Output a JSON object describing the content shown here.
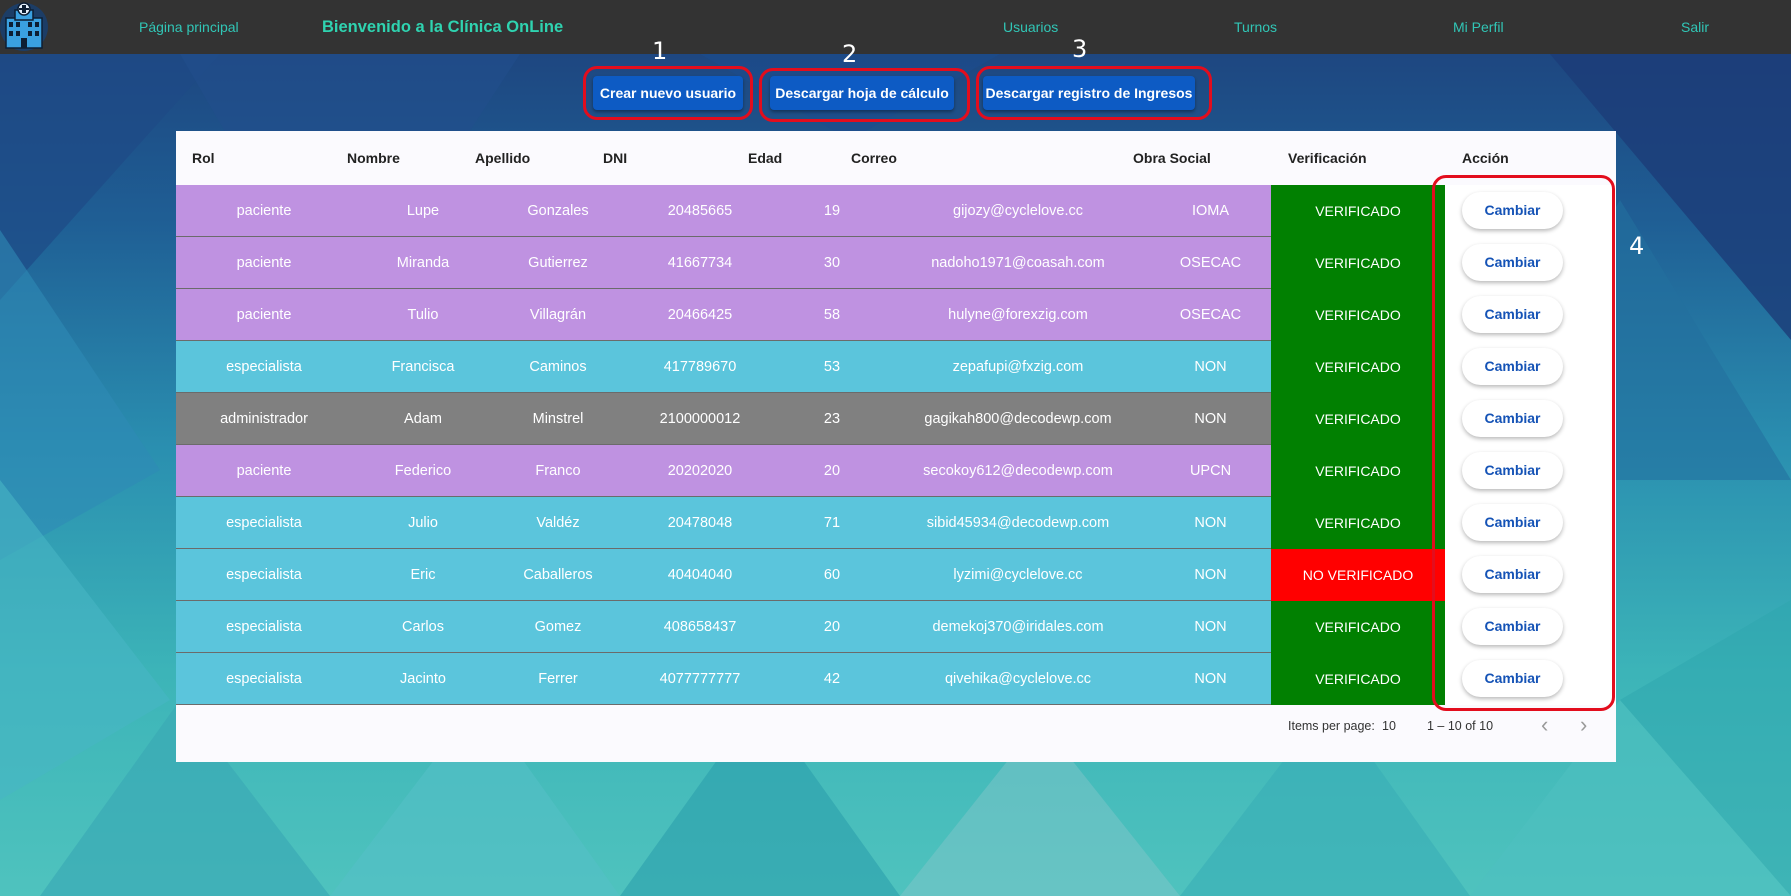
{
  "nav": {
    "home": "Página principal",
    "title": "Bienvenido a la Clínica OnLine",
    "users": "Usuarios",
    "turns": "Turnos",
    "profile": "Mi Perfil",
    "logout": "Salir"
  },
  "actions": {
    "create_user": "Crear nuevo usuario",
    "download_sheet": "Descargar hoja de cálculo",
    "download_log": "Descargar registro de Ingresos"
  },
  "annotations": [
    "1",
    "2",
    "3",
    "4"
  ],
  "table": {
    "headers": [
      "Rol",
      "Nombre",
      "Apellido",
      "DNI",
      "Edad",
      "Correo",
      "Obra Social",
      "Verificación",
      "Acción"
    ],
    "rows": [
      {
        "rol": "paciente",
        "nombre": "Lupe",
        "apellido": "Gonzales",
        "dni": "20485665",
        "edad": "19",
        "correo": "gijozy@cyclelove.cc",
        "obra": "IOMA",
        "ver": "VERIFICADO",
        "accion": "Cambiar"
      },
      {
        "rol": "paciente",
        "nombre": "Miranda",
        "apellido": "Gutierrez",
        "dni": "41667734",
        "edad": "30",
        "correo": "nadoho1971@coasah.com",
        "obra": "OSECAC",
        "ver": "VERIFICADO",
        "accion": "Cambiar"
      },
      {
        "rol": "paciente",
        "nombre": "Tulio",
        "apellido": "Villagrán",
        "dni": "20466425",
        "edad": "58",
        "correo": "hulyne@forexzig.com",
        "obra": "OSECAC",
        "ver": "VERIFICADO",
        "accion": "Cambiar"
      },
      {
        "rol": "especialista",
        "nombre": "Francisca",
        "apellido": "Caminos",
        "dni": "417789670",
        "edad": "53",
        "correo": "zepafupi@fxzig.com",
        "obra": "NON",
        "ver": "VERIFICADO",
        "accion": "Cambiar"
      },
      {
        "rol": "administrador",
        "nombre": "Adam",
        "apellido": "Minstrel",
        "dni": "2100000012",
        "edad": "23",
        "correo": "gagikah800@decodewp.com",
        "obra": "NON",
        "ver": "VERIFICADO",
        "accion": "Cambiar"
      },
      {
        "rol": "paciente",
        "nombre": "Federico",
        "apellido": "Franco",
        "dni": "20202020",
        "edad": "20",
        "correo": "secokoy612@decodewp.com",
        "obra": "UPCN",
        "ver": "VERIFICADO",
        "accion": "Cambiar"
      },
      {
        "rol": "especialista",
        "nombre": "Julio",
        "apellido": "Valdéz",
        "dni": "20478048",
        "edad": "71",
        "correo": "sibid45934@decodewp.com",
        "obra": "NON",
        "ver": "VERIFICADO",
        "accion": "Cambiar"
      },
      {
        "rol": "especialista",
        "nombre": "Eric",
        "apellido": "Caballeros",
        "dni": "40404040",
        "edad": "60",
        "correo": "lyzimi@cyclelove.cc",
        "obra": "NON",
        "ver": "NO VERIFICADO",
        "accion": "Cambiar"
      },
      {
        "rol": "especialista",
        "nombre": "Carlos",
        "apellido": "Gomez",
        "dni": "408658437",
        "edad": "20",
        "correo": "demekoj370@iridales.com",
        "obra": "NON",
        "ver": "VERIFICADO",
        "accion": "Cambiar"
      },
      {
        "rol": "especialista",
        "nombre": "Jacinto",
        "apellido": "Ferrer",
        "dni": "4077777777",
        "edad": "42",
        "correo": "qivehika@cyclelove.cc",
        "obra": "NON",
        "ver": "VERIFICADO",
        "accion": "Cambiar"
      }
    ]
  },
  "pagination": {
    "items_per_page_label": "Items per page:",
    "items_per_page": "10",
    "range": "1 – 10 of 10"
  },
  "colors": {
    "paciente": "#bf92e1",
    "especialista": "#5bc5dc",
    "administrador": "#808080",
    "verificado": "#018001",
    "no_verificado": "#ff0000",
    "annotation": "#e30d1d",
    "button": "#0d5bc4"
  },
  "icons": {
    "logo": "hospital-icon",
    "prev": "chevron-left-icon",
    "next": "chevron-right-icon"
  }
}
